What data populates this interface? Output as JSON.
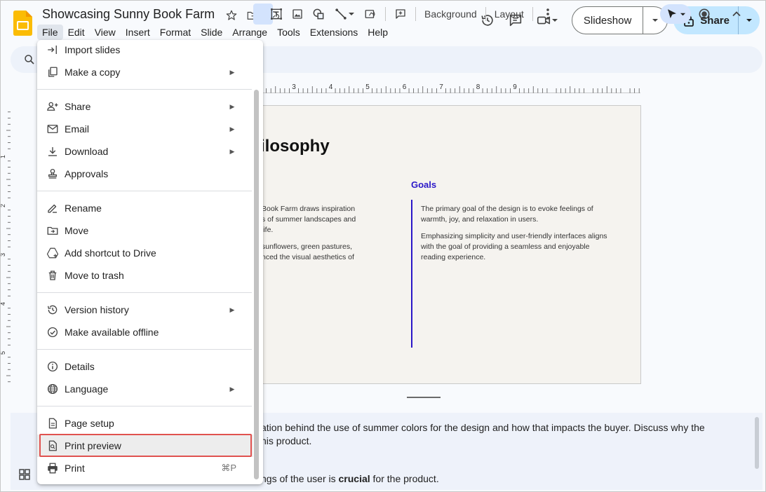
{
  "app": {
    "doc_title": "Showcasing Sunny Book Farm",
    "brand_color": "#fbbc04"
  },
  "menubar": {
    "items": [
      "File",
      "Edit",
      "View",
      "Insert",
      "Format",
      "Slide",
      "Arrange",
      "Tools",
      "Extensions",
      "Help"
    ],
    "active": "File"
  },
  "header": {
    "slideshow_label": "Slideshow",
    "share_label": "Share"
  },
  "toolbar": {
    "background_label": "Background",
    "layout_label": "Layout"
  },
  "ruler": {
    "top_marks": [
      "3",
      "4",
      "5",
      "6",
      "7",
      "8",
      "9"
    ],
    "left_marks": [
      "1",
      "2",
      "3",
      "4",
      "5"
    ]
  },
  "slide": {
    "title_partial": "ilosophy",
    "left_paragraphs": [
      "Book Farm draws inspiration\ns of summer landscapes and\n life.",
      "sunflowers, green pastures,\nnced the visual aesthetics of"
    ],
    "goals_label": "Goals",
    "goals_paragraphs": [
      "The primary goal of the design is to evoke feelings of warmth, joy, and relaxation in users.",
      "Emphasizing simplicity and user-friendly interfaces aligns with the goal of providing a seamless and enjoyable reading experience."
    ],
    "accent_color": "#2a17c8"
  },
  "notes": {
    "line1": "ation behind the use of summer colors for the design and how that impacts the buyer. Discuss why the",
    "line2": "his product.",
    "line3_pre": "ngs of the user is ",
    "line3_bold": "crucial",
    "line3_post": " for the product."
  },
  "file_menu": {
    "items": [
      {
        "label": "Import slides",
        "icon": "import-icon",
        "submenu": false
      },
      {
        "label": "Make a copy",
        "icon": "copy-icon",
        "submenu": true
      },
      {
        "label": "Share",
        "icon": "person-add-icon",
        "submenu": true
      },
      {
        "label": "Email",
        "icon": "email-icon",
        "submenu": true
      },
      {
        "label": "Download",
        "icon": "download-icon",
        "submenu": true
      },
      {
        "label": "Approvals",
        "icon": "approvals-icon",
        "submenu": false
      },
      {
        "label": "Rename",
        "icon": "rename-icon",
        "submenu": false
      },
      {
        "label": "Move",
        "icon": "move-folder-icon",
        "submenu": false
      },
      {
        "label": "Add shortcut to Drive",
        "icon": "drive-shortcut-icon",
        "submenu": false
      },
      {
        "label": "Move to trash",
        "icon": "trash-icon",
        "submenu": false
      },
      {
        "label": "Version history",
        "icon": "history-icon",
        "submenu": true
      },
      {
        "label": "Make available offline",
        "icon": "offline-icon",
        "submenu": false
      },
      {
        "label": "Details",
        "icon": "info-icon",
        "submenu": false
      },
      {
        "label": "Language",
        "icon": "globe-icon",
        "submenu": true
      },
      {
        "label": "Page setup",
        "icon": "page-icon",
        "submenu": false
      },
      {
        "label": "Print preview",
        "icon": "print-preview-icon",
        "submenu": false,
        "highlighted": true
      },
      {
        "label": "Print",
        "icon": "print-icon",
        "submenu": false,
        "shortcut": "⌘P"
      }
    ],
    "highlight_color": "#e0524f"
  }
}
